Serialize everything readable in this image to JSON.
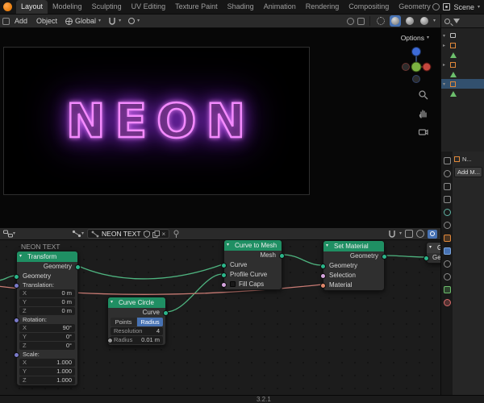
{
  "topbar": {
    "tabs": [
      "Layout",
      "Modeling",
      "Sculpting",
      "UV Editing",
      "Texture Paint",
      "Shading",
      "Animation",
      "Rendering",
      "Compositing",
      "Geometry Nodes"
    ],
    "active_tab": "Layout",
    "scene_label": "Scene"
  },
  "toolbar": {
    "add_menu": "Add",
    "object_menu": "Object",
    "orientation": "Global",
    "icons": [
      "editor-type",
      "globe",
      "magnet",
      "proportional-edit",
      "snap-target",
      "viewport-shading-wireframe",
      "viewport-shading-solid",
      "viewport-shading-material",
      "viewport-shading-rendered",
      "overlays",
      "gizmos"
    ]
  },
  "viewport": {
    "neon_text": "NEON",
    "options_label": "Options",
    "gizmo_axes": [
      "x-red",
      "y-green",
      "z-blue"
    ],
    "tool_icons": [
      "zoom-icon",
      "hand-icon",
      "camera-icon"
    ]
  },
  "outliner": {
    "row_icons": [
      "collection",
      "object",
      "mesh-data",
      "object",
      "mesh-data",
      "object-selected",
      "mesh-data"
    ]
  },
  "properties": {
    "object_name": "N...",
    "add_modifier_label": "Add M...",
    "tab_icons": [
      "tool",
      "render",
      "output",
      "view-layer",
      "scene",
      "world",
      "object",
      "modifiers",
      "particles",
      "physics",
      "object-data",
      "material"
    ]
  },
  "node_editor": {
    "breadcrumb": "NEON TEXT",
    "header": {
      "tree_name": "NEON TEXT"
    },
    "nodes": {
      "transform": {
        "title": "Transform",
        "output": "Geometry",
        "input": "Geometry",
        "sections": [
          {
            "label": "Translation:",
            "rows": [
              [
                "X",
                "0 m"
              ],
              [
                "Y",
                "0 m"
              ],
              [
                "Z",
                "0 m"
              ]
            ]
          },
          {
            "label": "Rotation:",
            "rows": [
              [
                "X",
                "90°"
              ],
              [
                "Y",
                "0°"
              ],
              [
                "Z",
                "0°"
              ]
            ]
          },
          {
            "label": "Scale:",
            "rows": [
              [
                "X",
                "1.000"
              ],
              [
                "Y",
                "1.000"
              ],
              [
                "Z",
                "1.000"
              ]
            ]
          }
        ]
      },
      "curve_circle": {
        "title": "Curve Circle",
        "output": "Curve",
        "mode_points": "Points",
        "mode_radius": "Radius",
        "resolution_label": "Resolution",
        "resolution_value": "4",
        "radius_label": "Radius",
        "radius_value": "0.01 m"
      },
      "curve_to_mesh": {
        "title": "Curve to Mesh",
        "output": "Mesh",
        "input_curve": "Curve",
        "input_profile": "Profile Curve",
        "input_fill_caps": "Fill Caps"
      },
      "set_material": {
        "title": "Set Material",
        "output": "Geometry",
        "input_geometry": "Geometry",
        "input_selection": "Selection",
        "input_material": "Material"
      },
      "group_output": {
        "title": "Group Output",
        "input": "Geometry"
      }
    }
  },
  "status_bar": {
    "version": "3.2.1"
  },
  "colors": {
    "neon": "#f48aff",
    "header_green": "#1f8f63",
    "accent": "#4772b3",
    "wire_green": "#4eb37f",
    "wire_material": "#c97b74",
    "socket_geometry": "#2bb58a",
    "socket_vector": "#7a7ac9",
    "socket_boolean": "#d6a4de",
    "socket_material": "#e0876b",
    "obj_orange": "#e0883a",
    "data_green": "#6cbf6c"
  }
}
